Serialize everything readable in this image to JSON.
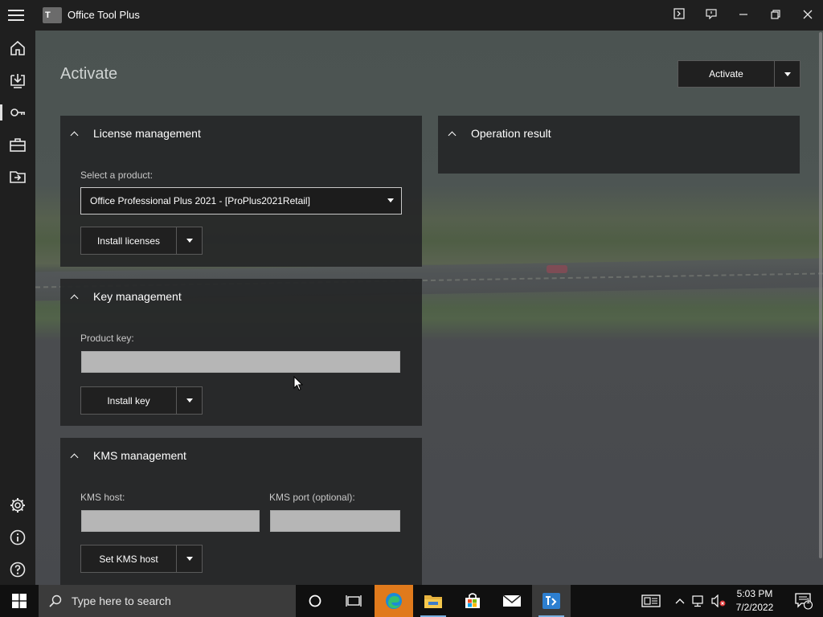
{
  "app": {
    "logo_text": "T",
    "title": "Office Tool Plus"
  },
  "page": {
    "title": "Activate",
    "activate_button": "Activate"
  },
  "license_panel": {
    "title": "License management",
    "product_label": "Select a product:",
    "product_value": "Office Professional Plus 2021 - [ProPlus2021Retail]",
    "install_button": "Install licenses"
  },
  "result_panel": {
    "title": "Operation result"
  },
  "key_panel": {
    "title": "Key management",
    "key_label": "Product key:",
    "key_value": "",
    "install_button": "Install key"
  },
  "kms_panel": {
    "title": "KMS management",
    "host_label": "KMS host:",
    "host_value": "",
    "port_label": "KMS port (optional):",
    "port_value": "",
    "set_button": "Set KMS host"
  },
  "sidebar": {
    "items": [
      "home-icon",
      "download-icon",
      "key-icon",
      "toolbox-icon",
      "folder-import-icon",
      "gear-icon",
      "info-icon",
      "help-icon"
    ],
    "active": "key-icon"
  },
  "taskbar": {
    "search_placeholder": "Type here to search",
    "time": "5:03 PM",
    "date": "7/2/2022",
    "notification_count": "1"
  },
  "colors": {
    "accent": "#7bb0e0",
    "titlebar": "#1f1f1f",
    "panel": "#262728"
  }
}
